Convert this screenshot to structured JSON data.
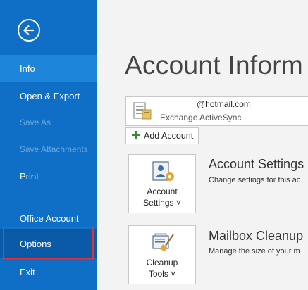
{
  "sidebar": {
    "back_icon": "back-arrow-icon",
    "items": [
      {
        "label": "Info"
      },
      {
        "label": "Open & Export"
      },
      {
        "label": "Save As"
      },
      {
        "label": "Save Attachments"
      },
      {
        "label": "Print"
      },
      {
        "label": "Office Account"
      },
      {
        "label": "Options"
      },
      {
        "label": "Exit"
      }
    ],
    "colors": {
      "background": "#0f6fc6",
      "active": "#1d86db",
      "highlight_border": "#e0313b"
    }
  },
  "main": {
    "title": "Account Inform",
    "account": {
      "email": "@hotmail.com",
      "type": "Exchange ActiveSync",
      "icon": "account-card-icon"
    },
    "add_account": {
      "label": "Add Account",
      "icon": "plus-icon"
    },
    "account_settings": {
      "button_line1": "Account",
      "button_line2": "Settings ˅",
      "title": "Account Settings",
      "description": "Change settings for this ac",
      "icon": "account-settings-icon"
    },
    "mailbox_cleanup": {
      "button_line1": "Cleanup",
      "button_line2": "Tools ˅",
      "title": "Mailbox Cleanup",
      "description": "Manage the size of your m",
      "icon": "cleanup-tools-icon"
    }
  }
}
